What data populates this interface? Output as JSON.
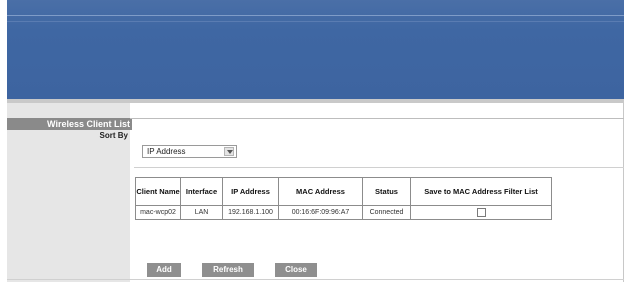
{
  "sidebar": {
    "title": "Wireless Client List",
    "sort_by_label": "Sort By"
  },
  "sort_select": {
    "value": "IP Address"
  },
  "table": {
    "headers": {
      "client_name": "Client Name",
      "interface": "Interface",
      "ip_address": "IP Address",
      "mac_address": "MAC Address",
      "status": "Status",
      "save": "Save to MAC Address Filter List"
    },
    "rows": [
      {
        "client_name": "mac-wcp02",
        "interface": "LAN",
        "ip_address": "192.168.1.100",
        "mac_address": "00:16:6F:09:96:A7",
        "status": "Connected",
        "save_checked": false
      }
    ]
  },
  "buttons": {
    "add": "Add",
    "refresh": "Refresh",
    "close": "Close"
  },
  "colors": {
    "header_blue": "#3f67a3",
    "sidebar_gray": "#e6e6e6",
    "button_gray": "#8f8f8f"
  }
}
